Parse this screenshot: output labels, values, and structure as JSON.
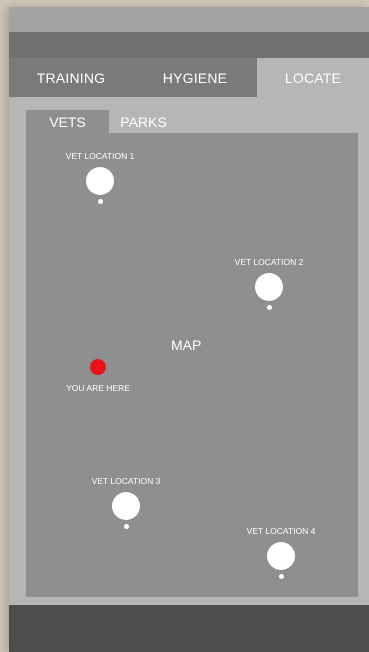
{
  "tabs": [
    {
      "label": "TRAINING",
      "active": false
    },
    {
      "label": "HYGIENE",
      "active": false
    },
    {
      "label": "LOCATE",
      "active": true
    }
  ],
  "subtabs": [
    {
      "label": "VETS",
      "active": true
    },
    {
      "label": "PARKS",
      "active": false
    }
  ],
  "map": {
    "label": "MAP",
    "you_are_here": "YOU ARE HERE",
    "vets": [
      {
        "label": "VET LOCATION 1"
      },
      {
        "label": "VET LOCATION 2"
      },
      {
        "label": "VET LOCATION 3"
      },
      {
        "label": "VET LOCATION 4"
      }
    ]
  },
  "colors": {
    "accent_marker": "#e8121c",
    "active_tab_bg": "#b6b6b6",
    "map_bg": "#8f8f8f"
  }
}
